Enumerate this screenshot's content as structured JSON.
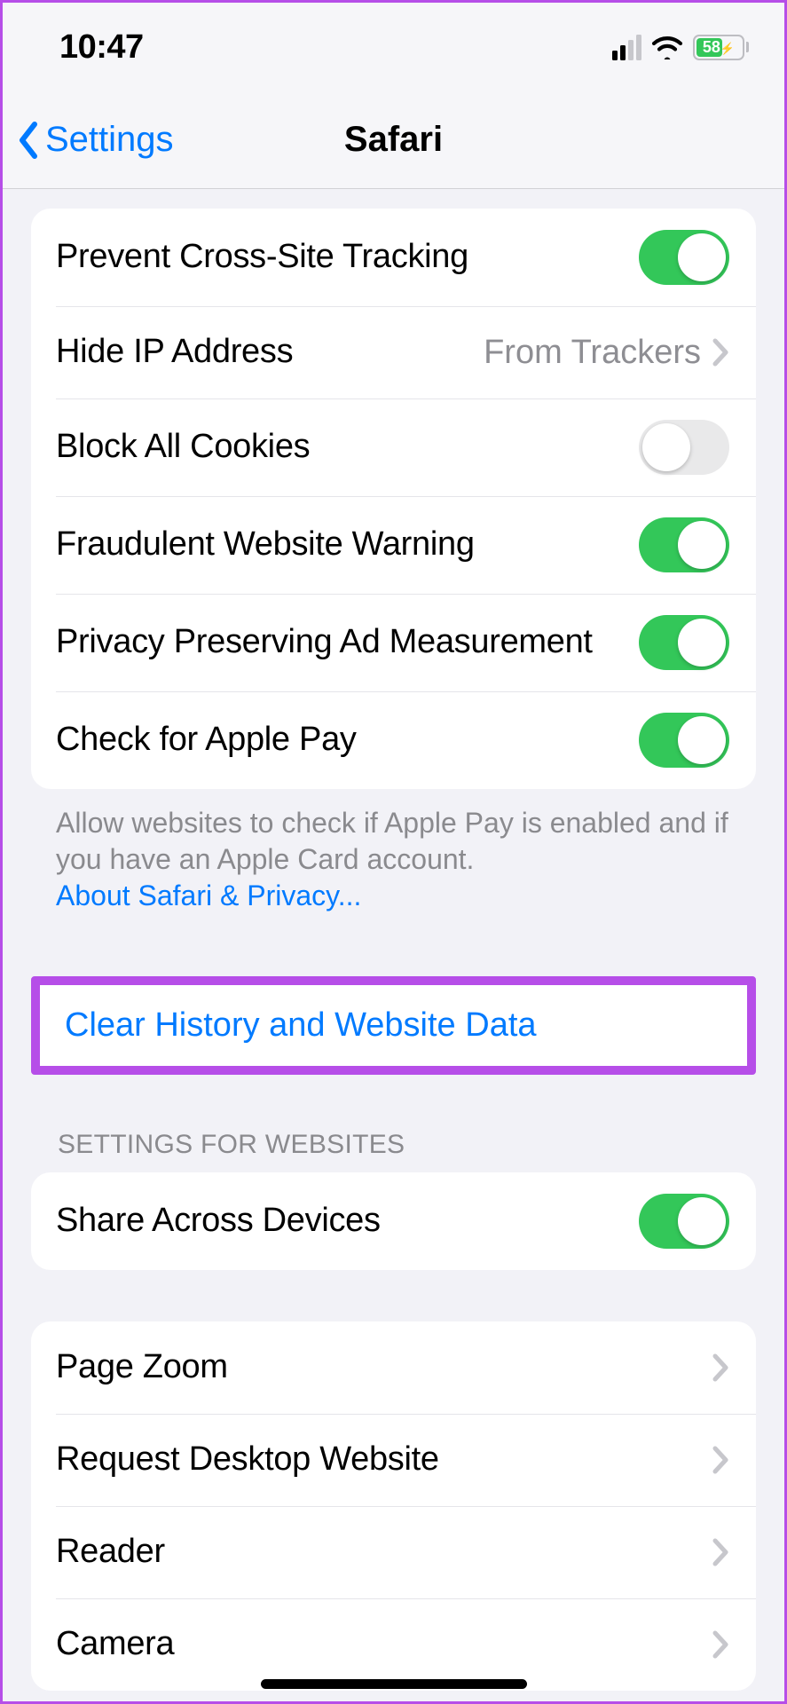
{
  "status": {
    "time": "10:47",
    "battery_pct": "58"
  },
  "nav": {
    "back_label": "Settings",
    "title": "Safari"
  },
  "privacy_group": {
    "items": [
      {
        "label": "Prevent Cross-Site Tracking",
        "type": "toggle",
        "on": true
      },
      {
        "label": "Hide IP Address",
        "type": "link",
        "value": "From Trackers"
      },
      {
        "label": "Block All Cookies",
        "type": "toggle",
        "on": false
      },
      {
        "label": "Fraudulent Website Warning",
        "type": "toggle",
        "on": true
      },
      {
        "label": "Privacy Preserving Ad Measurement",
        "type": "toggle",
        "on": true
      },
      {
        "label": "Check for Apple Pay",
        "type": "toggle",
        "on": true
      }
    ],
    "footer": "Allow websites to check if Apple Pay is enabled and if you have an Apple Card account.",
    "footer_link": "About Safari & Privacy..."
  },
  "clear": {
    "label": "Clear History and Website Data"
  },
  "websites_section": {
    "header": "SETTINGS FOR WEBSITES",
    "share": {
      "label": "Share Across Devices",
      "on": true
    },
    "items": [
      {
        "label": "Page Zoom"
      },
      {
        "label": "Request Desktop Website"
      },
      {
        "label": "Reader"
      },
      {
        "label": "Camera"
      }
    ]
  }
}
